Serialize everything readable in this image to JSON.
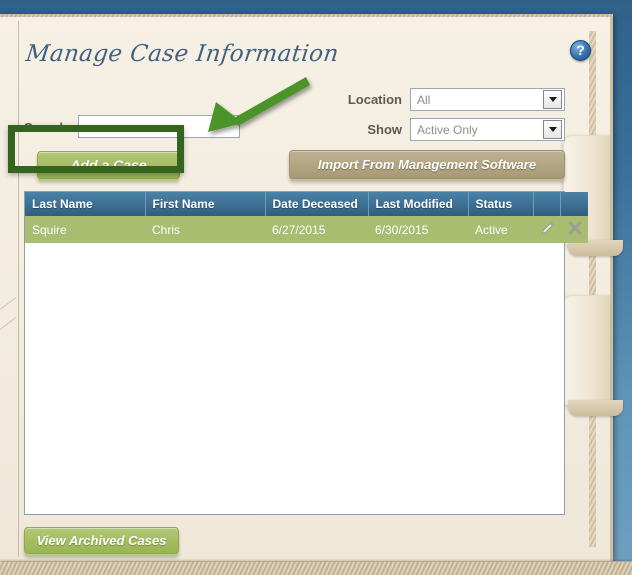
{
  "window": {
    "title": "Manage Case Information"
  },
  "help": {
    "icon": "help-icon",
    "glyph": "?"
  },
  "search": {
    "label": "Search",
    "value": "",
    "placeholder": ""
  },
  "filters": {
    "location": {
      "label": "Location",
      "value": "All"
    },
    "show": {
      "label": "Show",
      "value": "Active Only"
    }
  },
  "buttons": {
    "add_case": "Add a Case",
    "import": "Import From Management Software",
    "view_archived": "View Archived Cases"
  },
  "grid": {
    "columns": [
      "Last Name",
      "First Name",
      "Date Deceased",
      "Last Modified",
      "Status",
      "",
      ""
    ],
    "rows": [
      {
        "last_name": "Squire",
        "first_name": "Chris",
        "date_deceased": "6/27/2015",
        "last_modified": "6/30/2015",
        "status": "Active",
        "edit_icon": "pencil-icon",
        "delete_icon": "delete-x-icon"
      }
    ]
  },
  "annotations": {
    "highlight_target": "Add a Case",
    "arrow_color": "#4c9429",
    "box_color": "#34641e"
  },
  "colors": {
    "accent_blue": "#3c6f93",
    "row_green": "#a9bd71",
    "button_green": "#a6bd63",
    "button_tan": "#b3a684",
    "paper": "#f3ecdf",
    "backdrop": "#3c7099"
  }
}
